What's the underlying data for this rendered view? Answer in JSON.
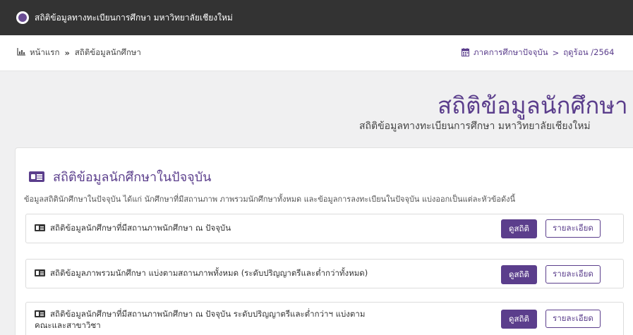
{
  "app": {
    "title": "สถิติข้อมูลทางทะเบียนการศึกษา มหาวิทยาลัยเชียงใหม่"
  },
  "breadcrumb": {
    "home": "หน้าแรก",
    "separator": "»",
    "current": "สถิติข้อมูลนักศึกษา",
    "term_label": "ภาคการศึกษาปัจจุบัน",
    "term_separator": ">",
    "term_value": "ฤดูร้อน /2564"
  },
  "hero": {
    "title": "สถิติข้อมูลนักศึกษา",
    "subtitle": "สถิติข้อมูลทางทะเบียนการศึกษา มหาวิทยาลัยเชียงใหม่"
  },
  "section": {
    "title": "สถิติข้อมูลนักศึกษาในปัจจุบัน",
    "description": "ข้อมูลสถิตินักศึกษาในปัจจุบัน ได้แก่ นักศึกษาที่มีสถานภาพ ภาพรวมนักศึกษาทั้งหมด และข้อมูลการลงทะเบียนในปัจจุบัน แบ่งออกเป็นแต่ละหัวข้อดังนี้",
    "items": [
      {
        "label": "สถิติข้อมูลนักศึกษาที่มีสถานภาพนักศึกษา ณ ปัจจุบัน",
        "stat_button": "ดูสถิติ",
        "detail_button": "รายละเอียด"
      },
      {
        "label": "สถิติข้อมูลภาพรวมนักศึกษา แบ่งตามสถานภาพทั้งหมด (ระดับปริญญาตรีและต่ำกว่าทั้งหมด)",
        "stat_button": "ดูสถิติ",
        "detail_button": "รายละเอียด"
      },
      {
        "label_line1": "สถิติข้อมูลนักศึกษาที่มีสถานภาพนักศึกษา ณ ปัจจุบัน ระดับปริญญาตรีและต่ำกว่าฯ แบ่งตาม",
        "label_line2": "คณะและสาขาวิชา",
        "stat_button": "ดูสถิติ",
        "detail_button": "รายละเอียด"
      }
    ]
  },
  "colors": {
    "accent": "#5b3e8c",
    "topbar": "#333333",
    "background": "#f0f0f1"
  },
  "icons": {
    "logo": "university-seal-icon",
    "home": "bar-chart-icon",
    "calendar": "calendar-icon",
    "section": "id-card-icon"
  }
}
